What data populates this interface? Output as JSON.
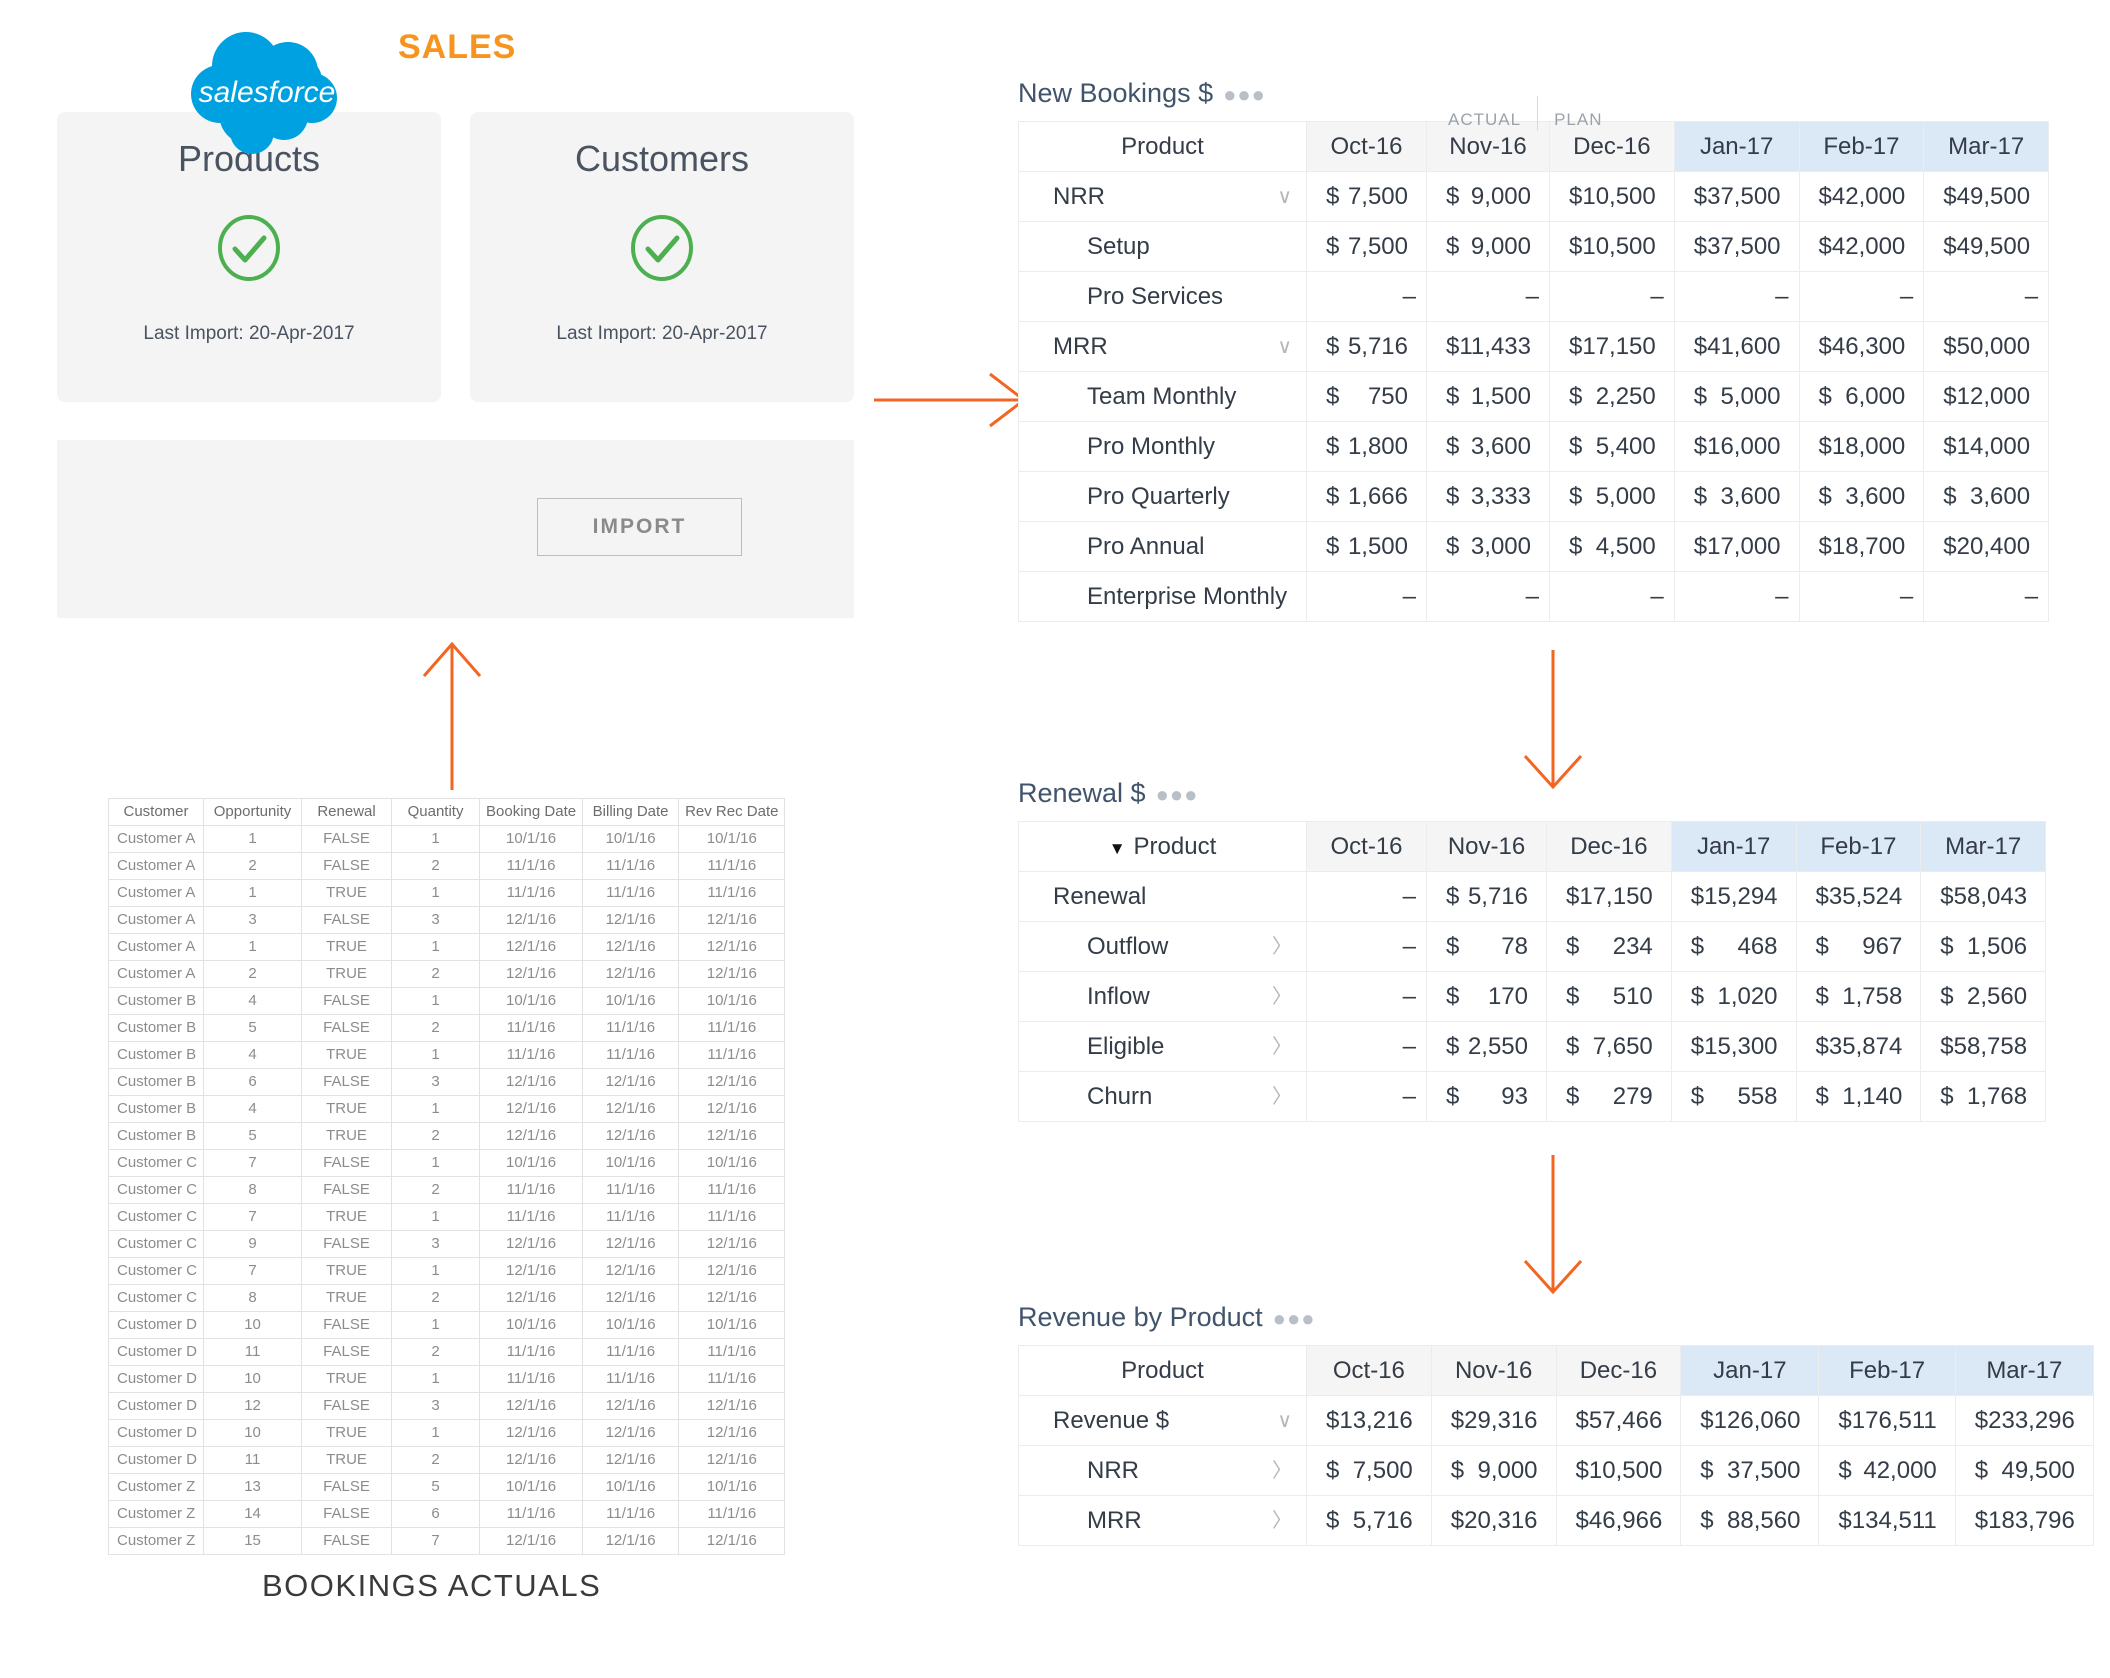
{
  "header": {
    "title": "SALES"
  },
  "cards": [
    {
      "name": "products",
      "title": "Products",
      "status_icon": "check-circle-icon",
      "subtitle": "Last Import: 20-Apr-2017"
    },
    {
      "name": "customers",
      "title": "Customers",
      "status_icon": "check-circle-icon",
      "subtitle": "Last Import: 20-Apr-2017"
    }
  ],
  "import_panel": {
    "logo": "salesforce-logo",
    "logo_text": "salesforce",
    "button_label": "IMPORT"
  },
  "actuals": {
    "caption": "BOOKINGS ACTUALS",
    "columns": [
      "Customer",
      "Opportunity",
      "Renewal",
      "Quantity",
      "Booking Date",
      "Billing Date",
      "Rev Rec Date"
    ],
    "rows": [
      [
        "Customer A",
        "1",
        "FALSE",
        "1",
        "10/1/16",
        "10/1/16",
        "10/1/16"
      ],
      [
        "Customer A",
        "2",
        "FALSE",
        "2",
        "11/1/16",
        "11/1/16",
        "11/1/16"
      ],
      [
        "Customer A",
        "1",
        "TRUE",
        "1",
        "11/1/16",
        "11/1/16",
        "11/1/16"
      ],
      [
        "Customer A",
        "3",
        "FALSE",
        "3",
        "12/1/16",
        "12/1/16",
        "12/1/16"
      ],
      [
        "Customer A",
        "1",
        "TRUE",
        "1",
        "12/1/16",
        "12/1/16",
        "12/1/16"
      ],
      [
        "Customer A",
        "2",
        "TRUE",
        "2",
        "12/1/16",
        "12/1/16",
        "12/1/16"
      ],
      [
        "Customer B",
        "4",
        "FALSE",
        "1",
        "10/1/16",
        "10/1/16",
        "10/1/16"
      ],
      [
        "Customer B",
        "5",
        "FALSE",
        "2",
        "11/1/16",
        "11/1/16",
        "11/1/16"
      ],
      [
        "Customer B",
        "4",
        "TRUE",
        "1",
        "11/1/16",
        "11/1/16",
        "11/1/16"
      ],
      [
        "Customer B",
        "6",
        "FALSE",
        "3",
        "12/1/16",
        "12/1/16",
        "12/1/16"
      ],
      [
        "Customer B",
        "4",
        "TRUE",
        "1",
        "12/1/16",
        "12/1/16",
        "12/1/16"
      ],
      [
        "Customer B",
        "5",
        "TRUE",
        "2",
        "12/1/16",
        "12/1/16",
        "12/1/16"
      ],
      [
        "Customer C",
        "7",
        "FALSE",
        "1",
        "10/1/16",
        "10/1/16",
        "10/1/16"
      ],
      [
        "Customer C",
        "8",
        "FALSE",
        "2",
        "11/1/16",
        "11/1/16",
        "11/1/16"
      ],
      [
        "Customer C",
        "7",
        "TRUE",
        "1",
        "11/1/16",
        "11/1/16",
        "11/1/16"
      ],
      [
        "Customer C",
        "9",
        "FALSE",
        "3",
        "12/1/16",
        "12/1/16",
        "12/1/16"
      ],
      [
        "Customer C",
        "7",
        "TRUE",
        "1",
        "12/1/16",
        "12/1/16",
        "12/1/16"
      ],
      [
        "Customer C",
        "8",
        "TRUE",
        "2",
        "12/1/16",
        "12/1/16",
        "12/1/16"
      ],
      [
        "Customer D",
        "10",
        "FALSE",
        "1",
        "10/1/16",
        "10/1/16",
        "10/1/16"
      ],
      [
        "Customer D",
        "11",
        "FALSE",
        "2",
        "11/1/16",
        "11/1/16",
        "11/1/16"
      ],
      [
        "Customer D",
        "10",
        "TRUE",
        "1",
        "11/1/16",
        "11/1/16",
        "11/1/16"
      ],
      [
        "Customer D",
        "12",
        "FALSE",
        "3",
        "12/1/16",
        "12/1/16",
        "12/1/16"
      ],
      [
        "Customer D",
        "10",
        "TRUE",
        "1",
        "12/1/16",
        "12/1/16",
        "12/1/16"
      ],
      [
        "Customer D",
        "11",
        "TRUE",
        "2",
        "12/1/16",
        "12/1/16",
        "12/1/16"
      ],
      [
        "Customer Z",
        "13",
        "FALSE",
        "5",
        "10/1/16",
        "10/1/16",
        "10/1/16"
      ],
      [
        "Customer Z",
        "14",
        "FALSE",
        "6",
        "11/1/16",
        "11/1/16",
        "11/1/16"
      ],
      [
        "Customer Z",
        "15",
        "FALSE",
        "7",
        "12/1/16",
        "12/1/16",
        "12/1/16"
      ]
    ]
  },
  "pivots": {
    "bookings": {
      "title": "New Bookings $",
      "menu_icon": "ellipsis-icon",
      "segment_labels": {
        "actual": "ACTUAL",
        "plan": "PLAN"
      },
      "product_header": "Product",
      "sort_indicator": "",
      "columns": [
        "Oct-16",
        "Nov-16",
        "Dec-16",
        "Jan-17",
        "Feb-17",
        "Mar-17"
      ],
      "plan_from_index": 3,
      "rows": [
        {
          "label": "NRR",
          "indent": 0,
          "icon": "chevron-down-icon",
          "values": [
            "7,500",
            "9,000",
            "10,500",
            "37,500",
            "42,000",
            "49,500"
          ]
        },
        {
          "label": "Setup",
          "indent": 1,
          "icon": "",
          "values": [
            "7,500",
            "9,000",
            "10,500",
            "37,500",
            "42,000",
            "49,500"
          ]
        },
        {
          "label": "Pro Services",
          "indent": 1,
          "icon": "",
          "values": [
            "-",
            "-",
            "-",
            "-",
            "-",
            "-"
          ]
        },
        {
          "label": "MRR",
          "indent": 0,
          "icon": "chevron-down-icon",
          "values": [
            "5,716",
            "11,433",
            "17,150",
            "41,600",
            "46,300",
            "50,000"
          ]
        },
        {
          "label": "Team Monthly",
          "indent": 1,
          "icon": "",
          "values": [
            "750",
            "1,500",
            "2,250",
            "5,000",
            "6,000",
            "12,000"
          ]
        },
        {
          "label": "Pro Monthly",
          "indent": 1,
          "icon": "",
          "values": [
            "1,800",
            "3,600",
            "5,400",
            "16,000",
            "18,000",
            "14,000"
          ]
        },
        {
          "label": "Pro Quarterly",
          "indent": 1,
          "icon": "",
          "values": [
            "1,666",
            "3,333",
            "5,000",
            "3,600",
            "3,600",
            "3,600"
          ]
        },
        {
          "label": "Pro Annual",
          "indent": 1,
          "icon": "",
          "values": [
            "1,500",
            "3,000",
            "4,500",
            "17,000",
            "18,700",
            "20,400"
          ]
        },
        {
          "label": "Enterprise Monthly",
          "indent": 1,
          "icon": "",
          "values": [
            "-",
            "-",
            "-",
            "-",
            "-",
            "-"
          ]
        }
      ]
    },
    "renewal": {
      "title": "Renewal $",
      "menu_icon": "ellipsis-icon",
      "product_header": "Product",
      "sort_indicator": "▼",
      "columns": [
        "Oct-16",
        "Nov-16",
        "Dec-16",
        "Jan-17",
        "Feb-17",
        "Mar-17"
      ],
      "plan_from_index": 3,
      "rows": [
        {
          "label": "Renewal",
          "indent": 0,
          "icon": "",
          "values": [
            "-",
            "5,716",
            "17,150",
            "15,294",
            "35,524",
            "58,043"
          ]
        },
        {
          "label": "Outflow",
          "indent": 1,
          "icon": "chevron-right-icon",
          "values": [
            "-",
            "78",
            "234",
            "468",
            "967",
            "1,506"
          ]
        },
        {
          "label": "Inflow",
          "indent": 1,
          "icon": "chevron-right-icon",
          "values": [
            "-",
            "170",
            "510",
            "1,020",
            "1,758",
            "2,560"
          ]
        },
        {
          "label": "Eligible",
          "indent": 1,
          "icon": "chevron-right-icon",
          "values": [
            "-",
            "2,550",
            "7,650",
            "15,300",
            "35,874",
            "58,758"
          ]
        },
        {
          "label": "Churn",
          "indent": 1,
          "icon": "chevron-right-icon",
          "values": [
            "-",
            "93",
            "279",
            "558",
            "1,140",
            "1,768"
          ]
        }
      ]
    },
    "revenue": {
      "title": "Revenue by Product",
      "menu_icon": "ellipsis-icon",
      "product_header": "Product",
      "sort_indicator": "",
      "columns": [
        "Oct-16",
        "Nov-16",
        "Dec-16",
        "Jan-17",
        "Feb-17",
        "Mar-17"
      ],
      "plan_from_index": 3,
      "rows": [
        {
          "label": "Revenue $",
          "indent": 0,
          "icon": "chevron-down-icon",
          "values": [
            "13,216",
            "29,316",
            "57,466",
            "126,060",
            "176,511",
            "233,296"
          ]
        },
        {
          "label": "NRR",
          "indent": 1,
          "icon": "chevron-right-icon",
          "values": [
            "7,500",
            "9,000",
            "10,500",
            "37,500",
            "42,000",
            "49,500"
          ]
        },
        {
          "label": "MRR",
          "indent": 1,
          "icon": "chevron-right-icon",
          "values": [
            "5,716",
            "20,316",
            "46,966",
            "88,560",
            "134,511",
            "183,796"
          ]
        }
      ]
    }
  },
  "colors": {
    "accent_orange": "#F7941E",
    "arrow_orange": "#F26522",
    "check_green": "#4CAF50",
    "salesforce_blue": "#00A1E0",
    "plan_header_blue": "#dbe8f5",
    "actual_header_gray": "#f5f5f5"
  }
}
